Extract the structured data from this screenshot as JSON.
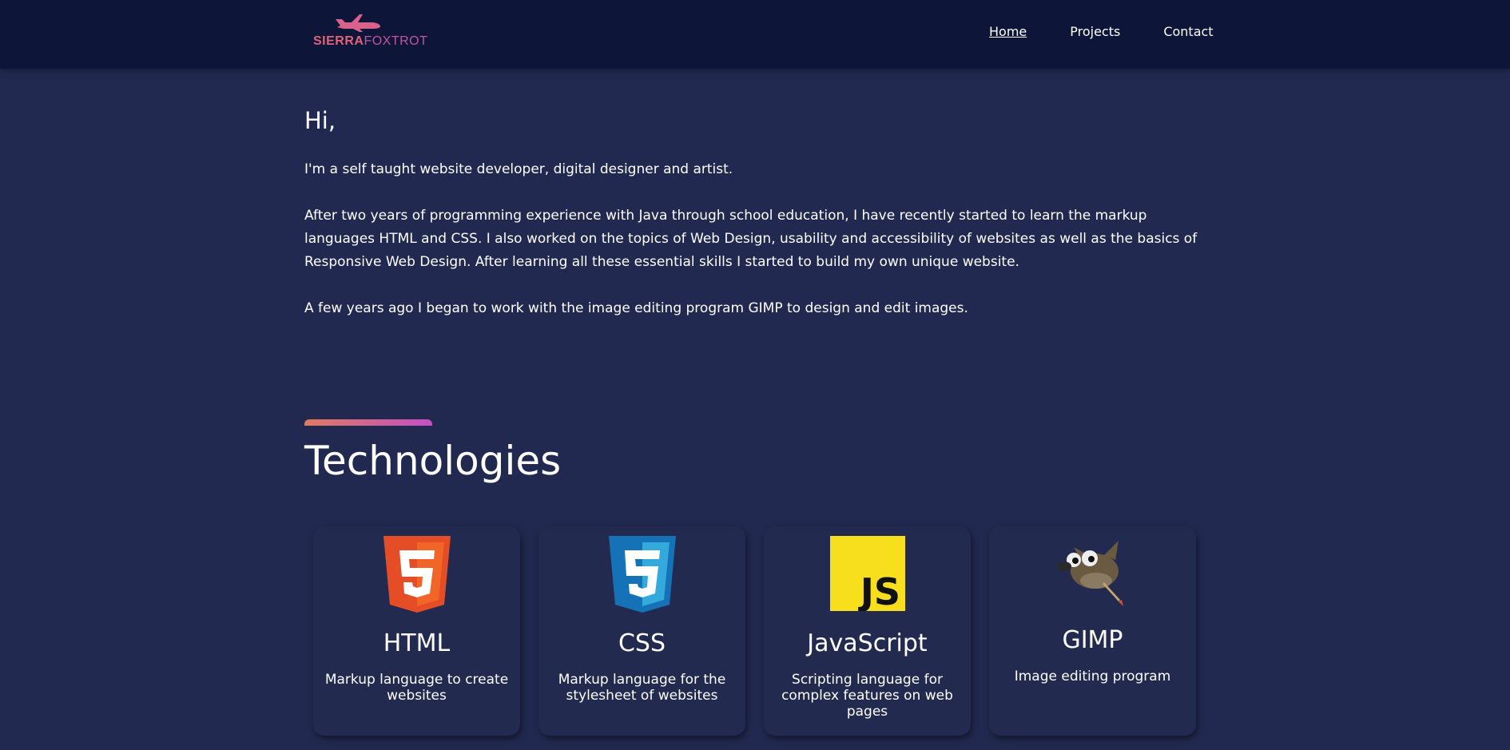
{
  "header": {
    "logo_part1": "SIERRA",
    "logo_part2": "FOXTROT",
    "nav": [
      {
        "label": "Home",
        "active": true
      },
      {
        "label": "Projects",
        "active": false
      },
      {
        "label": "Contact",
        "active": false
      }
    ]
  },
  "intro": {
    "greeting": "Hi,",
    "paragraphs": [
      "I'm a self taught website developer, digital designer and artist.",
      "After two years of programming experience with Java through school education, I have recently started to learn the markup languages HTML and CSS. I also worked on the topics of Web Design, usability and accessibility of websites as well as the basics of Responsive Web Design. After learning all these essential skills I started to build my own unique website.",
      "A few years ago I began to work with the image editing program GIMP to design and edit images."
    ]
  },
  "technologies": {
    "title": "Technologies",
    "cards": [
      {
        "icon": "html5-icon",
        "name": "HTML",
        "description": "Markup language to create websites"
      },
      {
        "icon": "css3-icon",
        "name": "CSS",
        "description": "Markup language for the stylesheet of websites"
      },
      {
        "icon": "javascript-icon",
        "name": "JavaScript",
        "description": "Scripting language for complex features on web pages"
      },
      {
        "icon": "gimp-icon",
        "name": "GIMP",
        "description": "Image editing program"
      }
    ]
  },
  "colors": {
    "background": "#212950",
    "navbar": "#0d1538",
    "accent_start": "#e07a5f",
    "accent_end": "#c34fc5"
  }
}
